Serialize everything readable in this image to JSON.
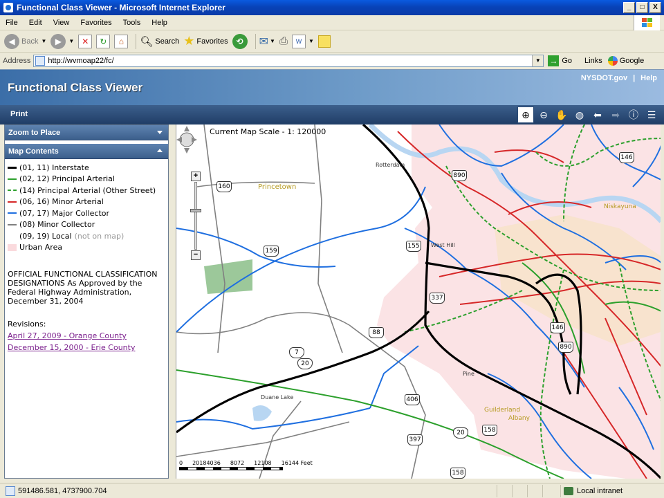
{
  "window": {
    "title": "Functional Class Viewer - Microsoft Internet Explorer",
    "minimize": "_",
    "maximize": "□",
    "close": "X"
  },
  "menu": [
    "File",
    "Edit",
    "View",
    "Favorites",
    "Tools",
    "Help"
  ],
  "toolbar": {
    "back_label": "Back",
    "search_label": "Search",
    "favorites_label": "Favorites"
  },
  "address": {
    "label": "Address",
    "url": "http://wvmoap22/fc/",
    "go_label": "Go",
    "links_label": "Links",
    "google_label": "Google"
  },
  "header": {
    "title": "Functional Class Viewer",
    "nysdot_link": "NYSDOT.gov",
    "separator": "|",
    "help_link": "Help",
    "print_label": "Print"
  },
  "panels": {
    "zoom_to_place": "Zoom to Place",
    "map_contents": "Map Contents"
  },
  "legend": [
    {
      "label": "(01, 11) Interstate",
      "color": "#000000",
      "style": "solid-thick",
      "note": ""
    },
    {
      "label": "(02, 12) Principal Arterial",
      "color": "#2ca02c",
      "style": "solid",
      "note": ""
    },
    {
      "label": "(14) Principal Arterial (Other Street)",
      "color": "#2ca02c",
      "style": "dashed",
      "note": ""
    },
    {
      "label": "(06, 16) Minor Arterial",
      "color": "#d62728",
      "style": "solid",
      "note": ""
    },
    {
      "label": "(07, 17) Major Collector",
      "color": "#1f6fe0",
      "style": "solid",
      "note": ""
    },
    {
      "label": "(08) Minor Collector",
      "color": "#808080",
      "style": "solid",
      "note": ""
    },
    {
      "label": "(09, 19) Local",
      "color": "",
      "style": "none",
      "note": "(not on map)"
    },
    {
      "label": "Urban Area",
      "color": "#fadadd",
      "style": "box",
      "note": ""
    }
  ],
  "official_text": "OFFICIAL FUNCTIONAL CLASSIFICATION DESIGNATIONS As Approved by the Federal Highway Administration, December 31, 2004",
  "revisions": {
    "label": "Revisions:",
    "items": [
      "April 27, 2009 - Orange County",
      "December 15, 2000 - Erie County"
    ]
  },
  "map": {
    "scale_text": "Current Map Scale - 1: 120000",
    "scalebar_labels": [
      "0",
      "20184036",
      "8072",
      "12108",
      "16144 Feet"
    ],
    "places": [
      "Princetown",
      "Duane Lake",
      "West Hill",
      "Niskayuna",
      "Guilderland",
      "Albany",
      "Rotterdam",
      "Pine"
    ],
    "shields": [
      "160",
      "159",
      "337",
      "88",
      "7",
      "20",
      "406",
      "397",
      "20",
      "158",
      "158",
      "146",
      "146",
      "890",
      "155",
      "890"
    ]
  },
  "status": {
    "coords": "591486.581, 4737900.704",
    "zone": "Local intranet"
  }
}
